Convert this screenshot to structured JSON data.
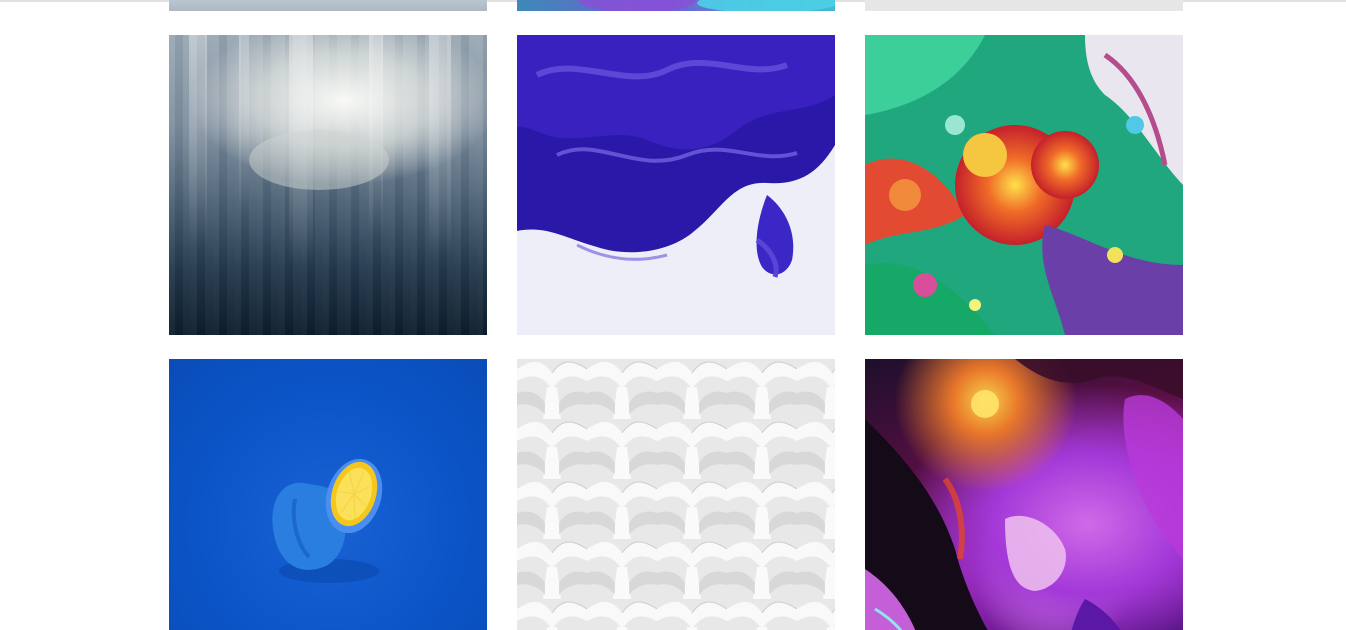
{
  "gallery": {
    "rows": [
      [
        {
          "name": "tile-water-surface"
        },
        {
          "name": "tile-cyan-abstract"
        },
        {
          "name": "tile-grey-texture"
        }
      ],
      [
        {
          "name": "tile-foggy-gradient"
        },
        {
          "name": "tile-purple-ink"
        },
        {
          "name": "tile-fluid-art"
        }
      ],
      [
        {
          "name": "tile-blue-lemon"
        },
        {
          "name": "tile-white-weave"
        },
        {
          "name": "tile-neon-abstract"
        }
      ]
    ]
  },
  "colors": {
    "background": "#ffffff",
    "divider": "#e2e2e2"
  }
}
